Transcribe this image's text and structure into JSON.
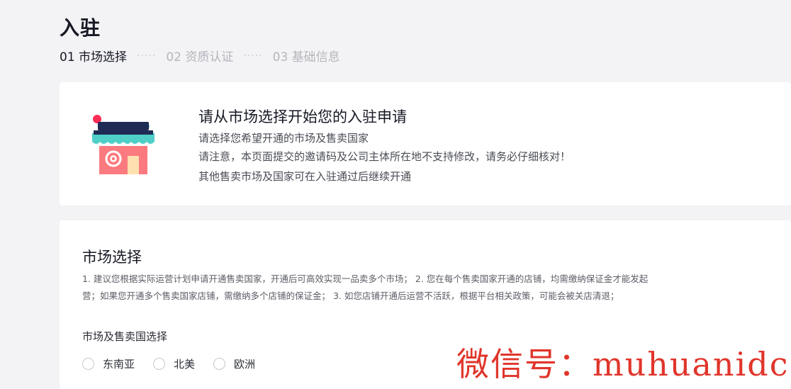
{
  "page": {
    "title": "入驻"
  },
  "steps": [
    {
      "label": "01 市场选择",
      "active": true
    },
    {
      "label": "02 资质认证",
      "active": false
    },
    {
      "label": "03 基础信息",
      "active": false
    }
  ],
  "step_separator": "·····",
  "intro": {
    "title": "请从市场选择开始您的入驻申请",
    "lines": [
      "请选择您希望开通的市场及售卖国家",
      "请注意，本页面提交的邀请码及公司主体所在地不支持修改，请务必仔细核对！",
      "其他售卖市场及国家可在入驻通过后继续开通"
    ]
  },
  "market_section": {
    "title": "市场选择",
    "description_lines": [
      "1. 建议您根据实际运营计划申请开通售卖国家，开通后可高效实现一品卖多个市场； 2. 您在每个售卖国家开通的店铺，均需缴纳保证金才能发起",
      "营；如果您开通多个售卖国家店铺，需缴纳多个店铺的保证金； 3. 如您店铺开通后运营不活跃，根据平台相关政策，可能会被关店清退；"
    ],
    "group_label": "市场及售卖国选择",
    "options": [
      "东南亚",
      "北美",
      "欧洲"
    ]
  },
  "watermark": "微信号：muhuanidc",
  "colors": {
    "accent": "#fe2c55",
    "watermark": "#e0352b",
    "shop_awning": "#4fcfc8",
    "shop_body": "#fb7a7f"
  }
}
